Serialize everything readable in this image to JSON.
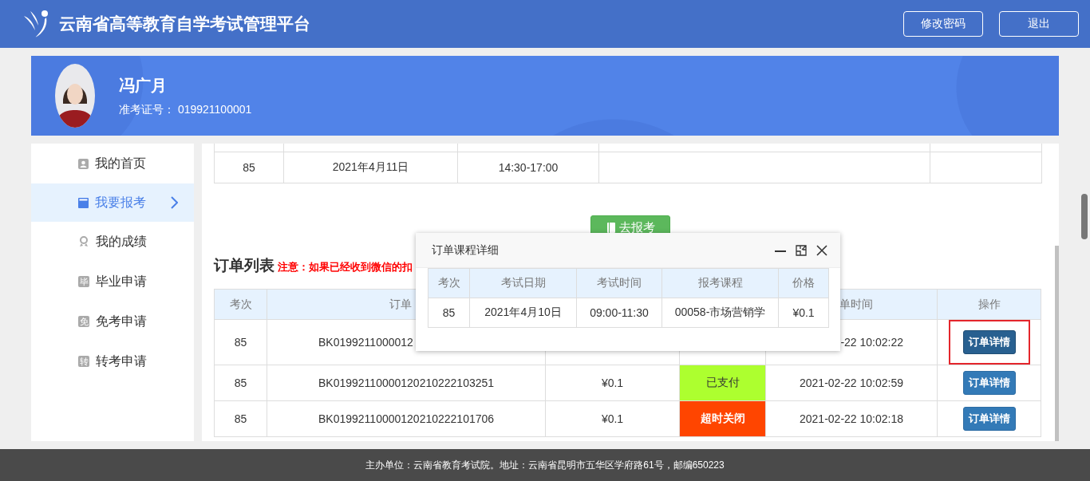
{
  "header": {
    "title": "云南省高等教育自学考试管理平台",
    "buttons": [
      "修改密码",
      "退出"
    ]
  },
  "profile": {
    "name": "冯广月",
    "id_text": "准考证号： 019921100001"
  },
  "sidebar": {
    "items": [
      {
        "label": "我的首页",
        "kind": "person",
        "selected": false
      },
      {
        "label": "我要报考",
        "kind": "card",
        "selected": true
      },
      {
        "label": "我的成绩",
        "kind": "medal",
        "selected": false
      },
      {
        "label": "毕业申请",
        "kind": "glyph",
        "glyph": "毕",
        "selected": false
      },
      {
        "label": "免考申请",
        "kind": "glyph",
        "glyph": "免",
        "selected": false
      },
      {
        "label": "转考申请",
        "kind": "glyph",
        "glyph": "转",
        "selected": false
      }
    ]
  },
  "exam_table": {
    "rows": [
      {
        "cells": [
          "85",
          "2021年4月11日",
          "14:30-17:00"
        ]
      }
    ]
  },
  "register_button": "去报考",
  "orders": {
    "title": "订单列表",
    "note": "注意：如果已经收到微信的扣",
    "columns": [
      "考次",
      "订单",
      null,
      null,
      "单时间",
      "操作"
    ],
    "rows": [
      {
        "round": "85",
        "order_no": "BK0199211000012",
        "time": "-22 10:02:22",
        "action": "订单详情",
        "highlighted": true
      },
      {
        "round": "85",
        "order_no": "BK01992110000120210222103251",
        "amount": "¥0.1",
        "status": {
          "label": "已支付",
          "kind": "paid"
        },
        "time": "2021-02-22 10:02:59",
        "action": "订单详情",
        "highlighted": false
      },
      {
        "round": "85",
        "order_no": "BK01992110000120210222101706",
        "amount": "¥0.1",
        "status": {
          "label": "超时关闭",
          "kind": "closed"
        },
        "time": "2021-02-22 10:02:18",
        "action": "订单详情",
        "highlighted": false
      }
    ]
  },
  "modal": {
    "title": "订单课程详细",
    "columns": [
      "考次",
      "考试日期",
      "考试时间",
      "报考课程",
      "价格"
    ],
    "rows": [
      {
        "cells": [
          "85",
          "2021年4月10日",
          "09:00-11:30",
          "00058-市场营销学",
          "¥0.1"
        ]
      }
    ]
  },
  "footer": "主办单位：云南省教育考试院。地址：云南省昆明市五华区学府路61号，邮编650223"
}
